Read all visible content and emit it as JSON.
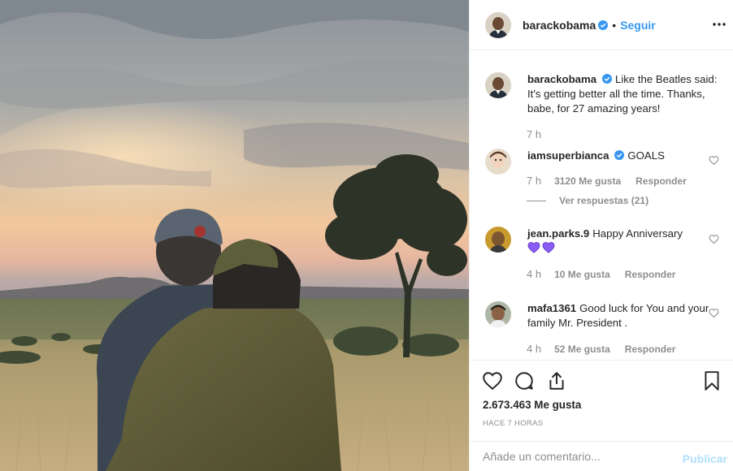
{
  "post": {
    "username": "barackobama",
    "follow_label": "Seguir",
    "separator": "•",
    "icons": {
      "verified": "verified-badge-icon",
      "more": "more-options-icon",
      "like": "heart-icon",
      "comment": "comment-bubble-icon",
      "share": "share-icon",
      "save": "bookmark-icon"
    },
    "caption": {
      "username": "barackobama",
      "text": "Like the Beatles said: It's getting better all the time. Thanks, babe, for 27 amazing years!",
      "time": "7 h"
    },
    "comments": [
      {
        "username": "iamsuperbianca",
        "text": "GOALS",
        "time": "7 h",
        "likes": "3120 Me gusta",
        "reply": "Responder",
        "view_replies": "Ver respuestas (21)"
      },
      {
        "username": "jean.parks.9",
        "text": "Happy Anniversary",
        "emoji": "purple-heart-icon",
        "time": "4 h",
        "likes": "10 Me gusta",
        "reply": "Responder"
      },
      {
        "username": "mafa1361",
        "text": "Good luck for You and your family Mr. President .",
        "time": "4 h",
        "likes": "52 Me gusta",
        "reply": "Responder"
      }
    ],
    "likes_total": "2.673.463 Me gusta",
    "posted_ago": "HACE 7 HORAS",
    "comment_placeholder": "Añade un comentario...",
    "publish_label": "Publicar",
    "colors": {
      "link_blue": "#3897f0",
      "publish_disabled": "#b2dffc",
      "muted_text": "#8e8e8e",
      "verified_blue": "#3897f0",
      "emoji_purple": "#8b5cf6"
    }
  }
}
